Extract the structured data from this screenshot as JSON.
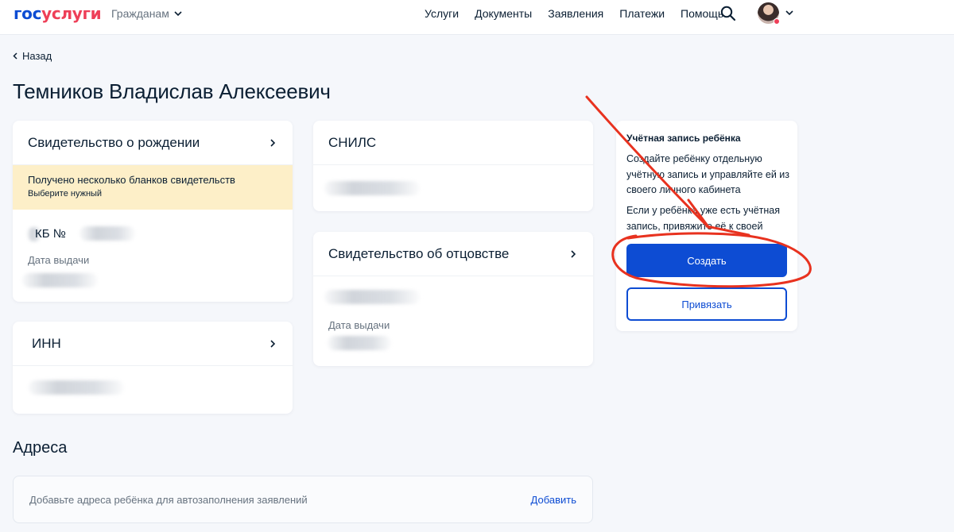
{
  "header": {
    "logo_part1": "гос",
    "logo_part2": "услуги",
    "audience": "Гражданам",
    "nav": [
      "Услуги",
      "Документы",
      "Заявления",
      "Платежи",
      "Помощь"
    ]
  },
  "back_label": "Назад",
  "page_title": "Темников Владислав Алексеевич",
  "birth_certificate": {
    "title": "Свидетельство о рождении",
    "notice_title": "Получено несколько бланков свидетельств",
    "notice_hint": "Выберите нужный",
    "number_label": "КБ №",
    "issue_label": "Дата выдачи"
  },
  "inn": {
    "title": "ИНН"
  },
  "snils": {
    "title": "СНИЛС"
  },
  "paternity": {
    "title": "Свидетельство об отцовстве",
    "issue_label": "Дата выдачи"
  },
  "child_account": {
    "title": "Учётная запись ребёнка",
    "text1": "Создайте ребёнку отдельную учётную запись и управляйте ей из своего личного кабинета",
    "text2": "Если у ребёнка уже есть учётная запись, привяжите её к своей",
    "create": "Создать",
    "link": "Привязать"
  },
  "addresses": {
    "title": "Адреса",
    "hint": "Добавьте адреса ребёнка для автозаполнения заявлений",
    "add": "Добавить"
  },
  "colors": {
    "primary": "#0d4cd3",
    "logo_red": "#ee3f58",
    "warning_bg": "#fdefc8",
    "annotation": "#e8321f"
  }
}
